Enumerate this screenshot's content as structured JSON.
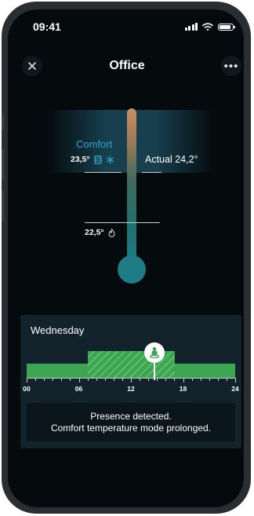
{
  "status_bar": {
    "time": "09:41"
  },
  "header": {
    "title": "Office"
  },
  "thermostat": {
    "mode_label": "Comfort",
    "comfort_setpoint": "23,5°",
    "eco_setpoint": "22,5°",
    "actual": "Actual 24,2°",
    "comfort_color": "#2fa6cf"
  },
  "schedule": {
    "day": "Wednesday",
    "hour_labels": [
      "00",
      "06",
      "12",
      "18",
      "24"
    ],
    "comfort_period_hours": [
      7,
      17
    ],
    "current_hour": 14.7,
    "message_line1": "Presence detected.",
    "message_line2": "Comfort temperature mode prolonged.",
    "bar_color": "#3ca552"
  },
  "icons": [
    "close-icon",
    "more-icon",
    "window-icon",
    "snowflake-icon",
    "flame-icon",
    "person-icon"
  ]
}
